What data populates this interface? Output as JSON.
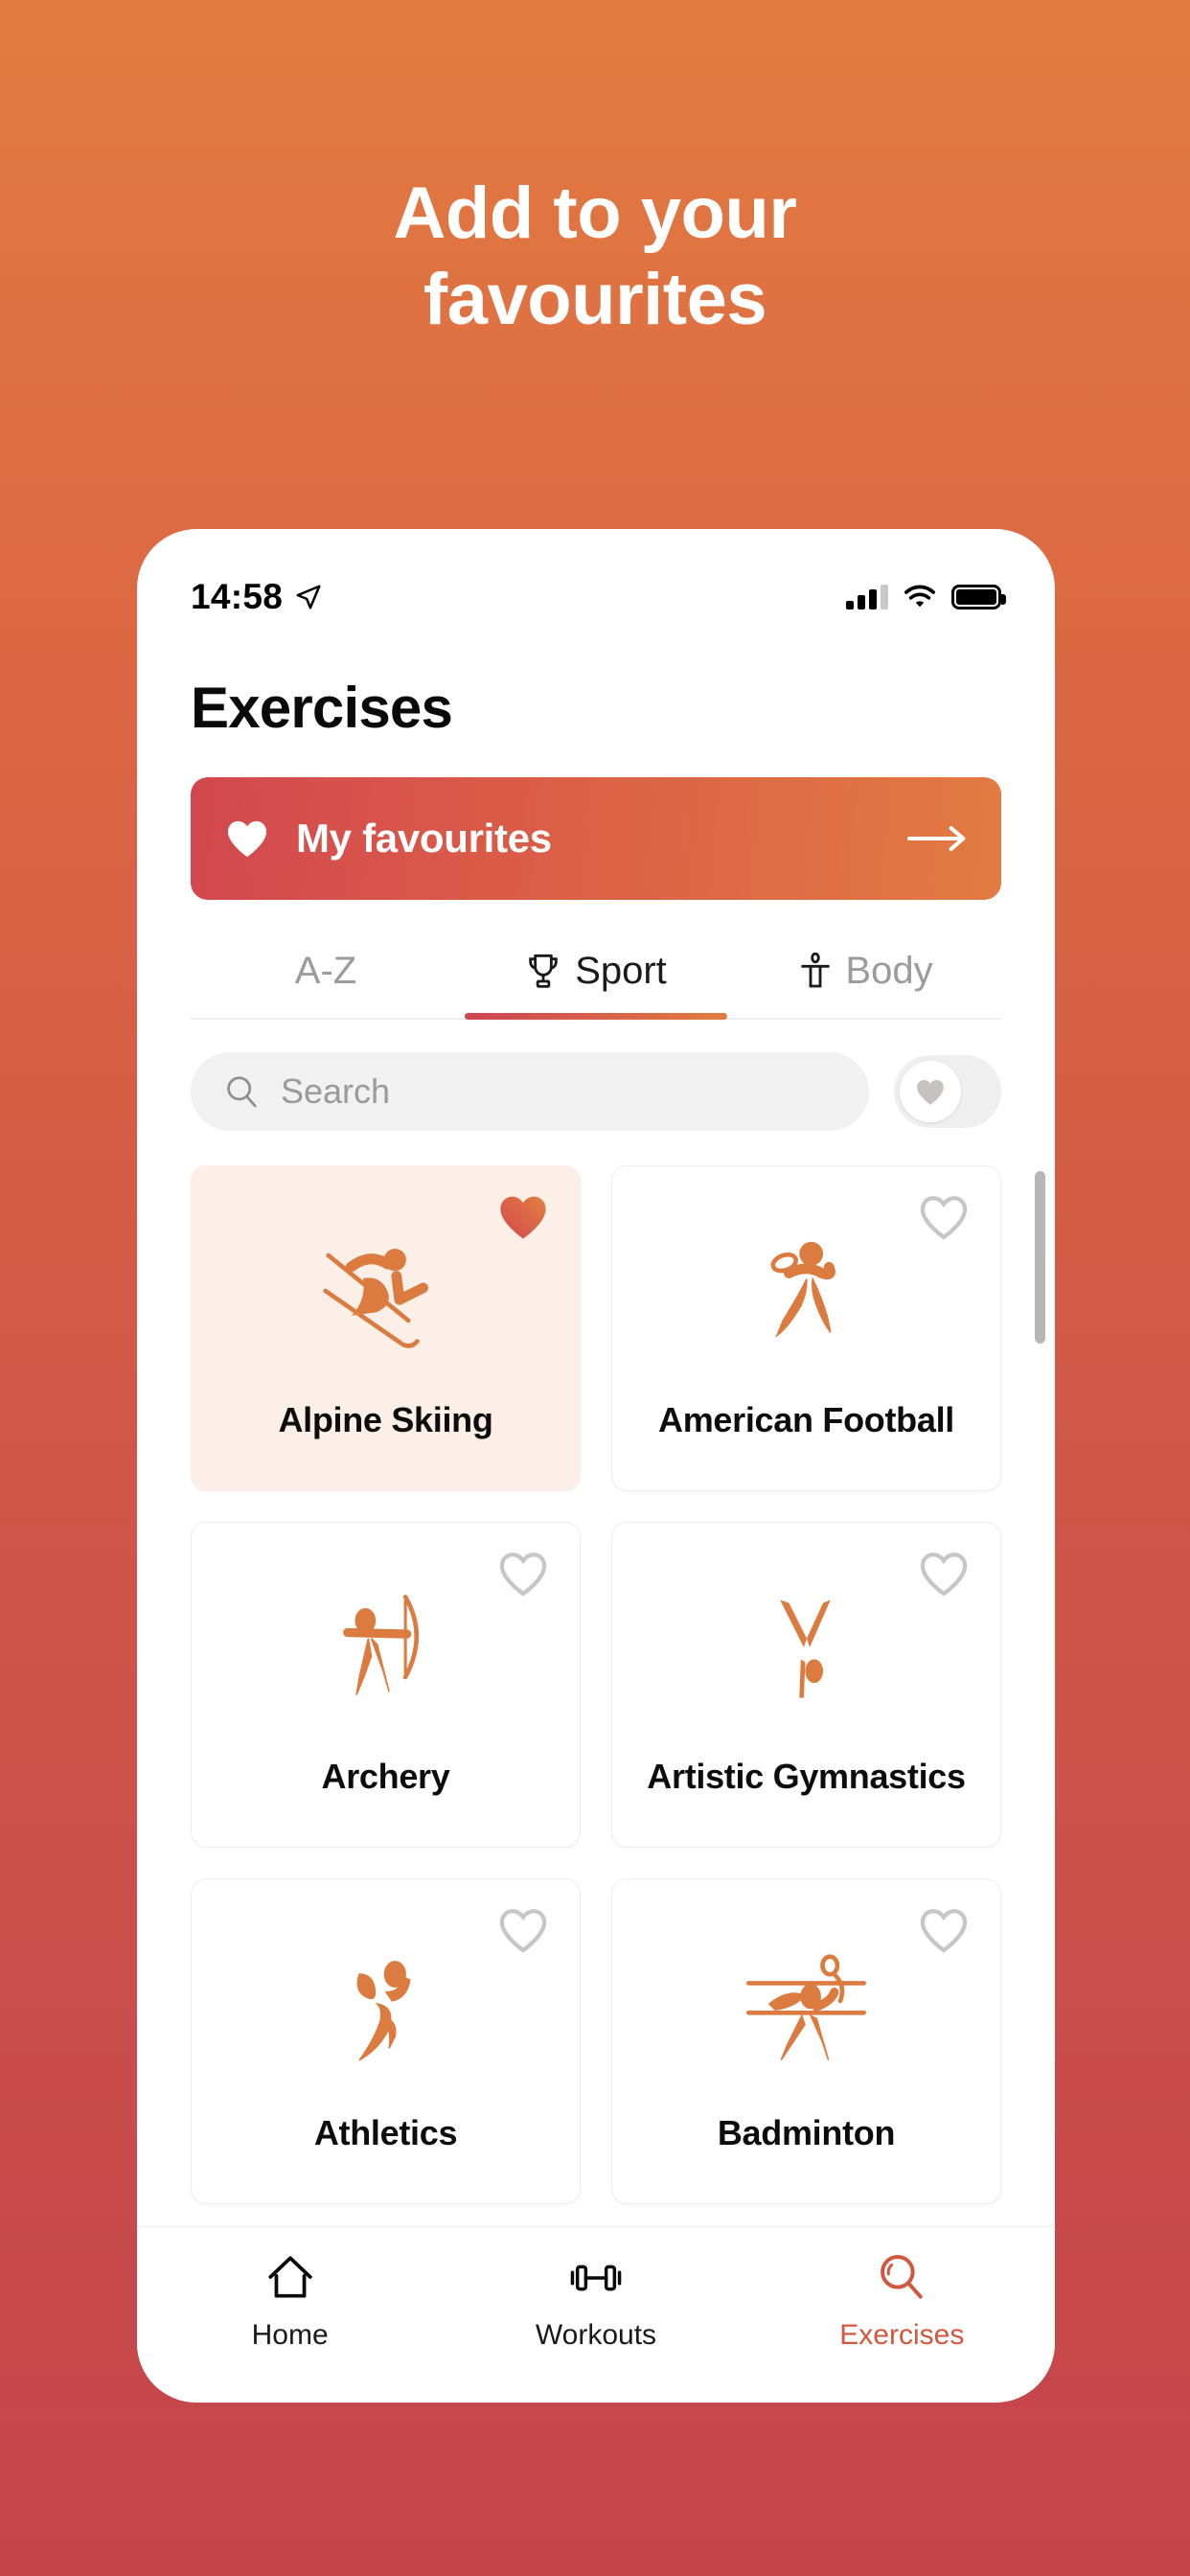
{
  "headline": {
    "line1": "Add to your",
    "line2": "favourites"
  },
  "theme": {
    "bg_top": "#E27B41",
    "bg_bottom": "#C4444C",
    "accent_orange": "#E07C40",
    "accent_red": "#CE4452",
    "pictogram": "#DB7B40",
    "faved_card_bg": "#FBEFE7",
    "muted_text": "#9B9B9B"
  },
  "status_bar": {
    "time": "14:58",
    "location_icon": "location-arrow-icon",
    "signal_icon": "cellular-signal-icon",
    "signal_bars_filled": 3,
    "signal_bars_total": 4,
    "wifi_icon": "wifi-icon",
    "battery_icon": "battery-full-icon",
    "battery_level": 100
  },
  "screen": {
    "title": "Exercises",
    "favourites_banner": {
      "icon": "heart-filled-icon",
      "label": "My favourites",
      "arrow_icon": "arrow-right-icon"
    },
    "tabs": [
      {
        "label": "A-Z",
        "icon": null,
        "active": false
      },
      {
        "label": "Sport",
        "icon": "trophy-icon",
        "active": true
      },
      {
        "label": "Body",
        "icon": "body-figure-icon",
        "active": false
      }
    ],
    "search": {
      "placeholder": "Search",
      "value": "",
      "icon": "search-icon"
    },
    "favourites_toggle": {
      "icon": "heart-icon",
      "state": "off"
    },
    "cards": [
      {
        "name": "Alpine Skiing",
        "pictogram": "alpine-skiing-icon",
        "favourited": true
      },
      {
        "name": "American Football",
        "pictogram": "american-football-icon",
        "favourited": false
      },
      {
        "name": "Archery",
        "pictogram": "archery-icon",
        "favourited": false
      },
      {
        "name": "Artistic Gymnastics",
        "pictogram": "artistic-gymnastics-icon",
        "favourited": false
      },
      {
        "name": "Athletics",
        "pictogram": "athletics-icon",
        "favourited": false
      },
      {
        "name": "Badminton",
        "pictogram": "badminton-icon",
        "favourited": false
      }
    ]
  },
  "bottom_nav": [
    {
      "label": "Home",
      "icon": "home-icon",
      "active": false
    },
    {
      "label": "Workouts",
      "icon": "dumbbell-icon",
      "active": false
    },
    {
      "label": "Exercises",
      "icon": "search-icon",
      "active": true
    }
  ]
}
